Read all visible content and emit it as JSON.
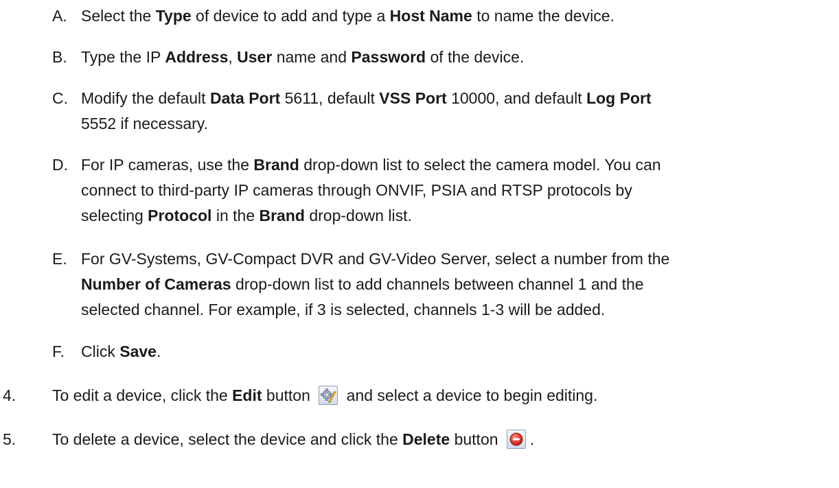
{
  "sub_steps": [
    {
      "marker": "A.",
      "parts": [
        {
          "t": "Select the "
        },
        {
          "b": "Type"
        },
        {
          "t": " of device to add and type a "
        },
        {
          "b": "Host Name"
        },
        {
          "t": " to name the device."
        }
      ]
    },
    {
      "marker": "B.",
      "parts": [
        {
          "t": "Type the IP "
        },
        {
          "b": "Address"
        },
        {
          "t": ", "
        },
        {
          "b": "User"
        },
        {
          "t": " name and "
        },
        {
          "b": "Password"
        },
        {
          "t": " of the device."
        }
      ]
    },
    {
      "marker": "C.",
      "line1": [
        {
          "t": "Modify the default "
        },
        {
          "b": "Data Port"
        },
        {
          "t": " 5611, default "
        },
        {
          "b": "VSS Port"
        },
        {
          "t": " 10000, and default "
        },
        {
          "b": "Log Port"
        }
      ],
      "line2": [
        {
          "t": "5552 if necessary."
        }
      ]
    },
    {
      "marker": "D.",
      "line1": [
        {
          "t": "For IP cameras, use the "
        },
        {
          "b": "Brand"
        },
        {
          "t": " drop-down list to select the camera model. You can"
        }
      ],
      "line2": [
        {
          "t": "connect to third-party IP cameras through ONVIF, PSIA and RTSP protocols by"
        }
      ],
      "line3": [
        {
          "t": "selecting "
        },
        {
          "b": "Protocol"
        },
        {
          "t": " in the "
        },
        {
          "b": "Brand"
        },
        {
          "t": " drop-down list."
        }
      ]
    },
    {
      "marker": "E.",
      "line1": [
        {
          "t": "For GV-Systems, GV-Compact DVR and GV-Video Server, select a number from the"
        }
      ],
      "line2": [
        {
          "b": "Number of Cameras"
        },
        {
          "t": " drop-down list to add channels between channel 1 and the"
        }
      ],
      "line3": [
        {
          "t": "selected channel. For example, if 3 is selected, channels 1-3 will be added."
        }
      ]
    },
    {
      "marker": "F.",
      "parts": [
        {
          "t": "Click "
        },
        {
          "b": "Save"
        },
        {
          "t": "."
        }
      ]
    }
  ],
  "steps": [
    {
      "marker": "4.",
      "before": "To edit a device, click the ",
      "bold": "Edit",
      "mid": " button",
      "after": "and select a device to begin editing.",
      "icon": "edit-icon"
    },
    {
      "marker": "5.",
      "before": "To delete a device, select the device and click the ",
      "bold": "Delete",
      "mid": " button",
      "after": ".",
      "icon": "delete-icon"
    }
  ]
}
